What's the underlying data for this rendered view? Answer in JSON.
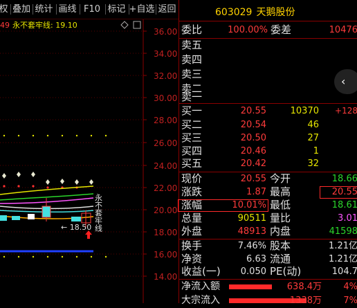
{
  "toolbar": {
    "items": [
      "权",
      "叠加",
      "统计",
      "画线",
      "F10",
      "标记",
      "+自选",
      "返回"
    ]
  },
  "chart": {
    "indicator_num": "49",
    "indicator_text": "永不套牢线: 19.10",
    "axis_labels": [
      "36.00",
      "34.00",
      "32.00",
      "30.00",
      "28.00",
      "26.00",
      "24.00",
      "22.00",
      "20.00",
      "18.00",
      "16.00",
      "14.00"
    ],
    "low_label": "← 18.50",
    "vertical_label": "永不套牢线"
  },
  "quote": {
    "code": "603029",
    "name": "天鹅股份",
    "weibi_label": "委比",
    "weibi_value": "100.00%",
    "weicha_label": "委差",
    "weicha_value": "10476",
    "sell": [
      {
        "label": "卖五",
        "price": "",
        "vol": ""
      },
      {
        "label": "卖四",
        "price": "",
        "vol": ""
      },
      {
        "label": "卖三",
        "price": "",
        "vol": ""
      },
      {
        "label": "卖二",
        "price": "",
        "vol": ""
      },
      {
        "label": "卖一",
        "price": "",
        "vol": ""
      }
    ],
    "buy": [
      {
        "label": "买一",
        "price": "20.55",
        "vol": "10370",
        "extra": "+128"
      },
      {
        "label": "买二",
        "price": "20.54",
        "vol": "46",
        "extra": ""
      },
      {
        "label": "买三",
        "price": "20.50",
        "vol": "27",
        "extra": ""
      },
      {
        "label": "买四",
        "price": "20.46",
        "vol": "1",
        "extra": ""
      },
      {
        "label": "买五",
        "price": "20.42",
        "vol": "32",
        "extra": ""
      }
    ],
    "stats": [
      {
        "l1": "现价",
        "v1": "20.55",
        "l2": "今开",
        "v2": "18.66"
      },
      {
        "l1": "涨跌",
        "v1": "1.87",
        "l2": "最高",
        "v2": "20.55"
      },
      {
        "l1": "涨幅",
        "v1": "10.01%",
        "l2": "最低",
        "v2": "18.61"
      },
      {
        "l1": "总量",
        "v1": "90511",
        "l2": "量比",
        "v2": "3.01"
      },
      {
        "l1": "外盘",
        "v1": "48913",
        "l2": "内盘",
        "v2": "41598"
      }
    ],
    "fund": [
      {
        "l1": "换手",
        "v1": "7.46%",
        "l2": "股本",
        "v2": "1.21亿"
      },
      {
        "l1": "净资",
        "v1": "6.63",
        "l2": "流通",
        "v2": "1.21亿"
      },
      {
        "l1": "收益(一)",
        "v1": "0.050",
        "l2": "PE(动)",
        "v2": "104.7"
      }
    ],
    "flow": [
      {
        "label": "净流入额",
        "amount": "638.4万",
        "pct": "4%",
        "fill": 0.55
      },
      {
        "label": "大宗流入",
        "amount": "1338万",
        "pct": "7%",
        "fill": 0.9
      }
    ]
  },
  "colors": {
    "up": "#ff3b3b",
    "down": "#2bd62b",
    "accent": "#ffd200",
    "border": "#8a0000"
  },
  "icons": {
    "collapse": "chevron-left-icon",
    "diamond": "diamond-icon",
    "box": "window-icon"
  }
}
